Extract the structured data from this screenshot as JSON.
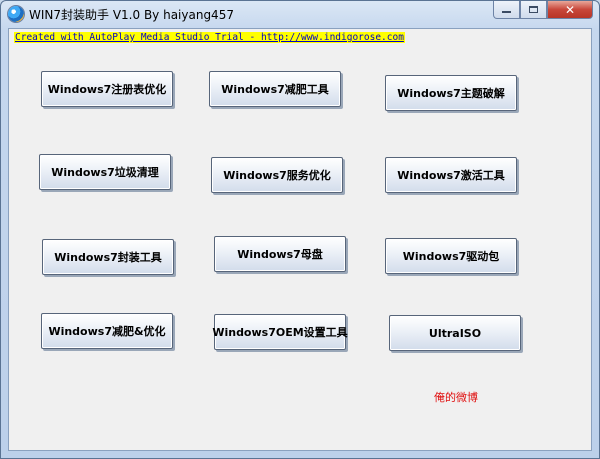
{
  "window": {
    "title": "WIN7封装助手 V1.0 By haiyang457",
    "icon": "app-globe-icon"
  },
  "caption_buttons": {
    "minimize": "minimize-icon",
    "maximize": "maximize-icon",
    "close": "close-icon",
    "close_glyph": "✕"
  },
  "trial_link": "Created with AutoPlay Media Studio Trial - http://www.indigorose.com",
  "buttons": [
    "Windows7注册表优化",
    "Windows7减肥工具",
    "Windows7主题破解",
    "Windows7垃圾清理",
    "Windows7服务优化",
    "Windows7激活工具",
    "Windows7封装工具",
    "Windows7母盘",
    "Windows7驱动包",
    "Windows7减肥&优化",
    "Windows7OEM设置工具",
    "UltraISO"
  ],
  "weibo_link": "俺的微博",
  "colors": {
    "link_highlight": "#ffff00",
    "link_text": "#0000c8",
    "weibo_text": "#e01010",
    "close_button": "#c8473a"
  }
}
